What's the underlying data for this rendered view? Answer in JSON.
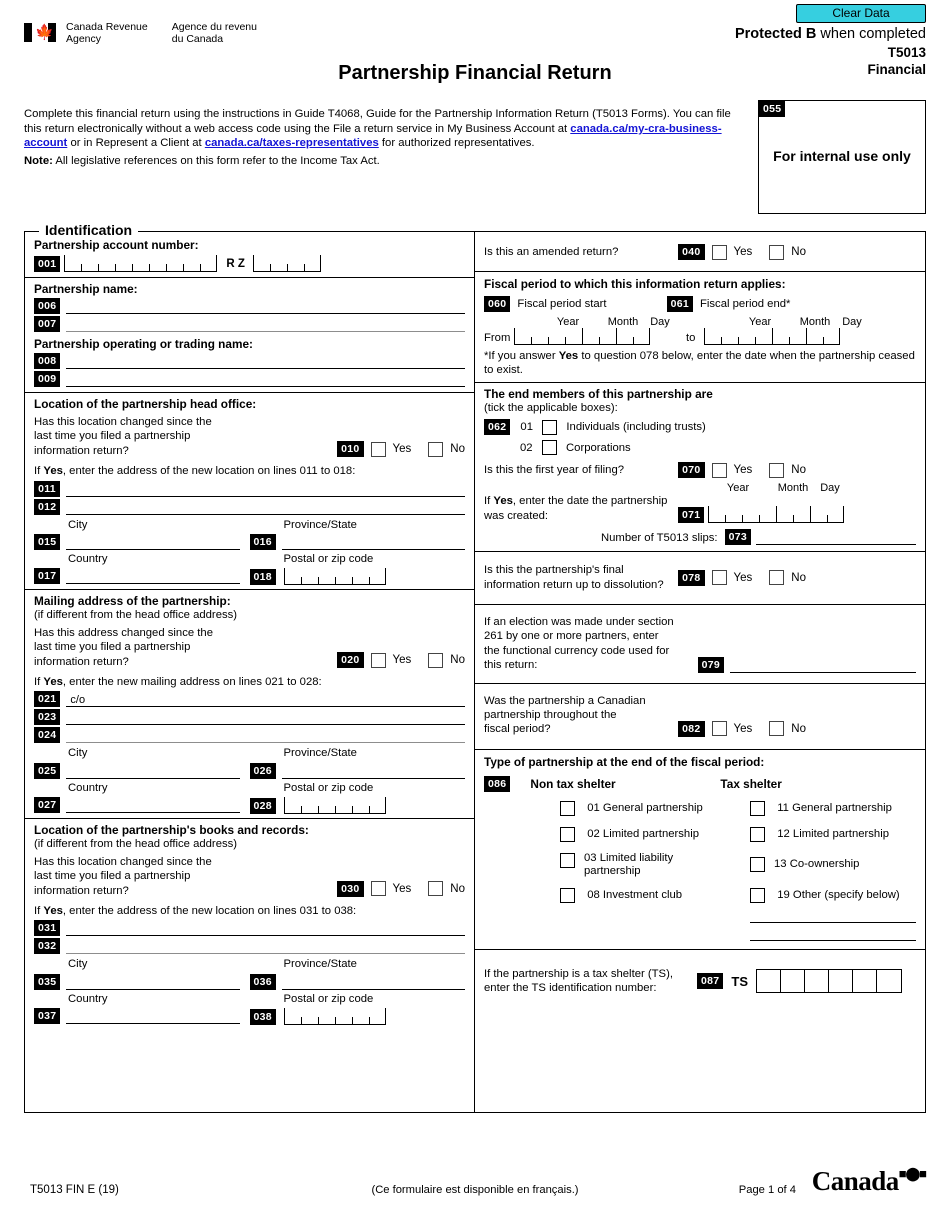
{
  "header": {
    "clear_data_label": "Clear Data",
    "clear_data_color": "#36cfe0",
    "agency_en": "Canada Revenue\nAgency",
    "agency_fr": "Agence du revenu\ndu Canada",
    "protected_prefix": "Protected B",
    "protected_suffix": " when completed",
    "form_code": "T5013",
    "form_kind": "Financial",
    "title": "Partnership Financial Return"
  },
  "intro": {
    "part1": "Complete this financial return using the instructions in Guide T4068, Guide for the Partnership Information Return (T5013 Forms). You can file this return electronically without a web access code using the File a return service in My Business Account at ",
    "link1": "canada.ca/my-cra-business-account",
    "part2": " or in Represent a Client at ",
    "link2": "canada.ca/taxes-representatives",
    "part3": " for authorized representatives.",
    "note_label": "Note:",
    "note_text": " All legislative references on this form refer to the Income Tax Act."
  },
  "internal_box": {
    "code": "055",
    "text": "For internal use only"
  },
  "identification": {
    "legend": "Identification",
    "account": {
      "label": "Partnership account number:",
      "code": "001",
      "bn_cells": 9,
      "rz": "R  Z",
      "ref_cells": 4
    },
    "name": {
      "label": "Partnership name:",
      "code1": "006",
      "code2": "007"
    },
    "trading": {
      "label": "Partnership operating or trading name:",
      "code1": "008",
      "code2": "009"
    },
    "head_office": {
      "label": "Location of the partnership head office:",
      "question": "Has this location changed since the\nlast time you filed a partnership\ninformation return?",
      "code": "010",
      "yes": "Yes",
      "no": "No",
      "if_yes": "If <b>Yes</b>, enter the address of the new location on lines 011 to 018:",
      "addr1": "011",
      "addr2": "012",
      "city_label": "City",
      "city_code": "015",
      "prov_label": "Province/State",
      "prov_code": "016",
      "country_label": "Country",
      "country_code": "017",
      "postal_label": "Postal or zip code",
      "postal_code": "018",
      "postal_cells": 6
    },
    "mailing": {
      "label": "Mailing address of the partnership:",
      "sublabel": "(if different from the head office address)",
      "question": "Has this address changed since the\nlast time you filed a partnership\ninformation return?",
      "code": "020",
      "yes": "Yes",
      "no": "No",
      "if_yes": "If <b>Yes</b>, enter the new mailing address on lines 021 to 028:",
      "co_label": "c/o",
      "addr1": "021",
      "addr2": "023",
      "addr3": "024",
      "city_label": "City",
      "city_code": "025",
      "prov_label": "Province/State",
      "prov_code": "026",
      "country_label": "Country",
      "country_code": "027",
      "postal_label": "Postal or zip code",
      "postal_code": "028",
      "postal_cells": 6
    },
    "books": {
      "label": "Location of the partnership's books and records:",
      "sublabel": "(if different from the head office address)",
      "question": "Has this location changed since the\nlast time you filed a partnership\ninformation return?",
      "code": "030",
      "yes": "Yes",
      "no": "No",
      "if_yes": "If <b>Yes</b>, enter the address of the new location on lines 031 to 038:",
      "addr1": "031",
      "addr2": "032",
      "city_label": "City",
      "city_code": "035",
      "prov_label": "Province/State",
      "prov_code": "036",
      "country_label": "Country",
      "country_code": "037",
      "postal_label": "Postal or zip code",
      "postal_code": "038",
      "postal_cells": 6
    },
    "amended": {
      "question": "Is this an amended return?",
      "code": "040",
      "yes": "Yes",
      "no": "No"
    },
    "fiscal": {
      "heading": "Fiscal period to which this information return applies:",
      "start_code": "060",
      "start_label": "Fiscal period start",
      "end_code": "061",
      "end_label": "Fiscal period end*",
      "year": "Year",
      "month": "Month",
      "day": "Day",
      "from": "From",
      "to": "to",
      "footnote": "*If you answer <b>Yes</b> to question 078 below, enter the date when the partnership ceased to exist."
    },
    "members": {
      "heading": "The end members of this partnership are",
      "subheading": "(tick the applicable boxes):",
      "code": "062",
      "options": [
        {
          "num": "01",
          "label": "Individuals (including trusts)"
        },
        {
          "num": "02",
          "label": "Corporations"
        }
      ],
      "first_year_q": "Is this the first year of filing?",
      "first_year_code": "070",
      "yes": "Yes",
      "no": "No",
      "created_q": "If <b>Yes</b>, enter the date the partnership\nwas created:",
      "created_code": "071",
      "year": "Year",
      "month": "Month",
      "day": "Day",
      "slips_label": "Number of T5013 slips:",
      "slips_code": "073"
    },
    "final_return": {
      "question": "Is this the partnership's final\ninformation return up to dissolution?",
      "code": "078",
      "yes": "Yes",
      "no": "No"
    },
    "election": {
      "question": "If an election was made under section\n261 by one or more partners, enter\nthe functional currency code used for\nthis return:",
      "code": "079"
    },
    "canadian": {
      "question": "Was the partnership a Canadian\npartnership throughout the\nfiscal period?",
      "code": "082",
      "yes": "Yes",
      "no": "No"
    },
    "type": {
      "heading": "Type of partnership at the end of the fiscal period:",
      "code": "086",
      "non_shelter_heading": "Non tax shelter",
      "shelter_heading": "Tax shelter",
      "non_shelter": [
        {
          "num": "01",
          "label": "General partnership"
        },
        {
          "num": "02",
          "label": "Limited partnership"
        },
        {
          "num": "03",
          "label": "Limited liability\npartnership"
        },
        {
          "num": "08",
          "label": "Investment club"
        }
      ],
      "shelter": [
        {
          "num": "11",
          "label": "General partnership"
        },
        {
          "num": "12",
          "label": "Limited partnership"
        },
        {
          "num": "13",
          "label": "Co-ownership"
        },
        {
          "num": "19",
          "label": "Other (specify below)"
        }
      ]
    },
    "ts": {
      "question": "If the partnership is a tax shelter (TS),\nenter the TS identification number:",
      "code": "087",
      "prefix": "TS",
      "cells": 6
    }
  },
  "footer": {
    "form_id": "T5013 FIN E (19)",
    "french_note": "(Ce formulaire est disponible en français.)",
    "page": "Page 1 of 4",
    "wordmark": "Canada"
  }
}
